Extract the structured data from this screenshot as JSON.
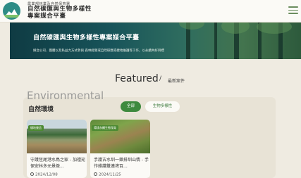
{
  "header": {
    "org": "農業部林業及自然保育署",
    "title_line1": "自然碳匯與生物多樣性",
    "title_line2": "專案媒合平臺"
  },
  "hero": {
    "title": "自然碳匯與生物多樣性專案媒合平臺",
    "subtitle": "媒合公司、團體以及私益力方式參與 森林經營或自然碳匯或棲地維護等工作，以永續共好目標"
  },
  "featured": {
    "title": "Featured",
    "separator": "/",
    "subtitle": "最新案件"
  },
  "section": {
    "title_en": "Environmental",
    "title_zh": "自然環境"
  },
  "tabs": [
    {
      "label": "全部",
      "active": true
    },
    {
      "label": "生物多樣性",
      "active": false
    }
  ],
  "cards": [
    {
      "badge": "棲地營造",
      "title": "守護恆尾港水鳥之家 - 加禮宛保安林多元景緻...",
      "date": "2024/12/08"
    },
    {
      "badge": "環境永續生態保育",
      "title": "手護古水圳一樂排圳山情 - 手作維護雙連埤百...",
      "date": "2024/11/25"
    }
  ],
  "colors": {
    "accent": "#3e8a3e",
    "background": "#efebe1"
  }
}
